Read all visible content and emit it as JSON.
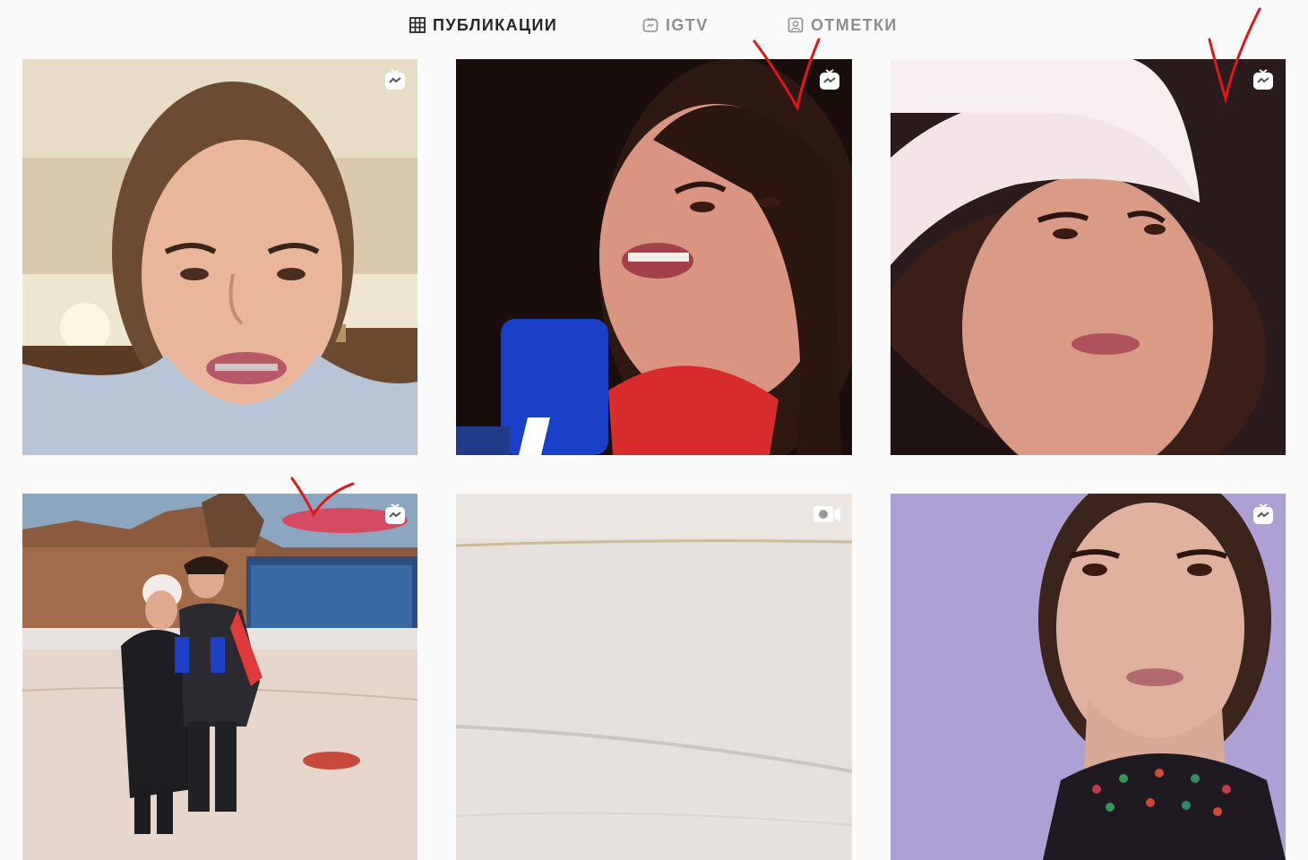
{
  "tabs": [
    {
      "label": "ПУБЛИКАЦИИ",
      "icon": "grid-icon",
      "active": true
    },
    {
      "label": "IGTV",
      "icon": "igtv-icon",
      "active": false
    },
    {
      "label": "ОТМЕТКИ",
      "icon": "tagged-icon",
      "active": false
    }
  ],
  "posts": [
    {
      "type": "igtv",
      "badge_icon": "igtv-icon",
      "annotated": false
    },
    {
      "type": "igtv",
      "badge_icon": "igtv-icon",
      "annotated": true
    },
    {
      "type": "igtv",
      "badge_icon": "igtv-icon",
      "annotated": true
    },
    {
      "type": "igtv",
      "badge_icon": "igtv-icon",
      "annotated": true
    },
    {
      "type": "video",
      "badge_icon": "video-camera-icon",
      "annotated": false
    },
    {
      "type": "igtv",
      "badge_icon": "igtv-icon",
      "annotated": false
    }
  ],
  "colors": {
    "background": "#fafafa",
    "tab_active": "#262626",
    "tab_inactive": "#8e8e8e",
    "annotation": "#e0161b"
  }
}
